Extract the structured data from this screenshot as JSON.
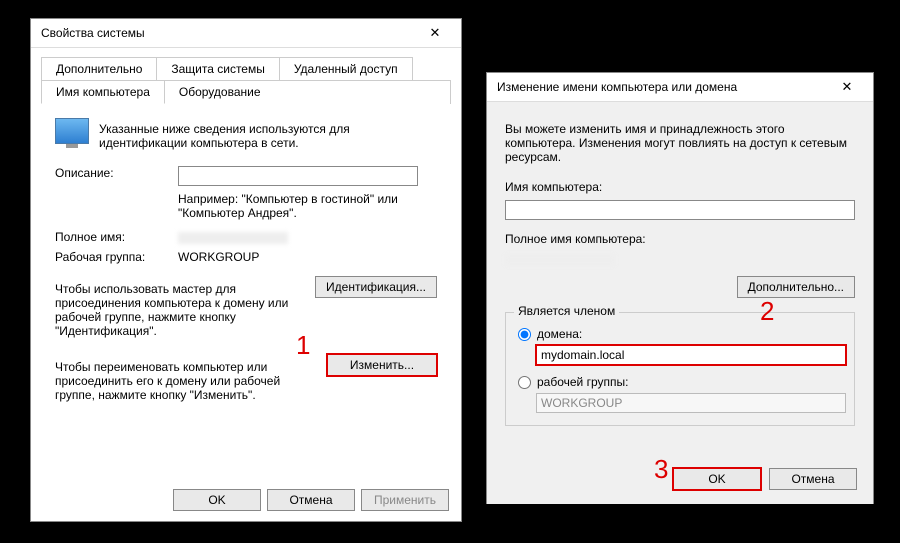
{
  "window1": {
    "title": "Свойства системы",
    "tabs_row1": [
      "Дополнительно",
      "Защита системы",
      "Удаленный доступ"
    ],
    "tabs_row2": [
      "Имя компьютера",
      "Оборудование"
    ],
    "active_tab": "Имя компьютера",
    "intro": "Указанные ниже сведения используются для идентификации компьютера в сети.",
    "desc_label": "Описание:",
    "desc_value": "",
    "desc_hint": "Например: \"Компьютер в гостиной\" или \"Компьютер Андрея\".",
    "fullname_label": "Полное имя:",
    "fullname_value": "",
    "workgroup_label": "Рабочая группа:",
    "workgroup_value": "WORKGROUP",
    "ident_text": "Чтобы использовать мастер для присоединения компьютера к домену или рабочей группе, нажмите кнопку \"Идентификация\".",
    "ident_btn": "Идентификация...",
    "change_text": "Чтобы переименовать компьютер или присоединить его к домену или рабочей группе, нажмите кнопку \"Изменить\".",
    "change_btn": "Изменить...",
    "ok": "OK",
    "cancel": "Отмена",
    "apply": "Применить"
  },
  "window2": {
    "title": "Изменение имени компьютера или домена",
    "intro": "Вы можете изменить имя и принадлежность этого компьютера. Изменения могут повлиять на доступ к сетевым ресурсам.",
    "name_label": "Имя компьютера:",
    "name_value": "",
    "fullname_label": "Полное имя компьютера:",
    "fullname_value": "",
    "more_btn": "Дополнительно...",
    "group_legend": "Является членом",
    "radio_domain": "домена:",
    "domain_value": "mydomain.local",
    "radio_workgroup": "рабочей группы:",
    "workgroup_value": "WORKGROUP",
    "ok": "OK",
    "cancel": "Отмена"
  },
  "annotations": {
    "n1": "1",
    "n2": "2",
    "n3": "3"
  }
}
